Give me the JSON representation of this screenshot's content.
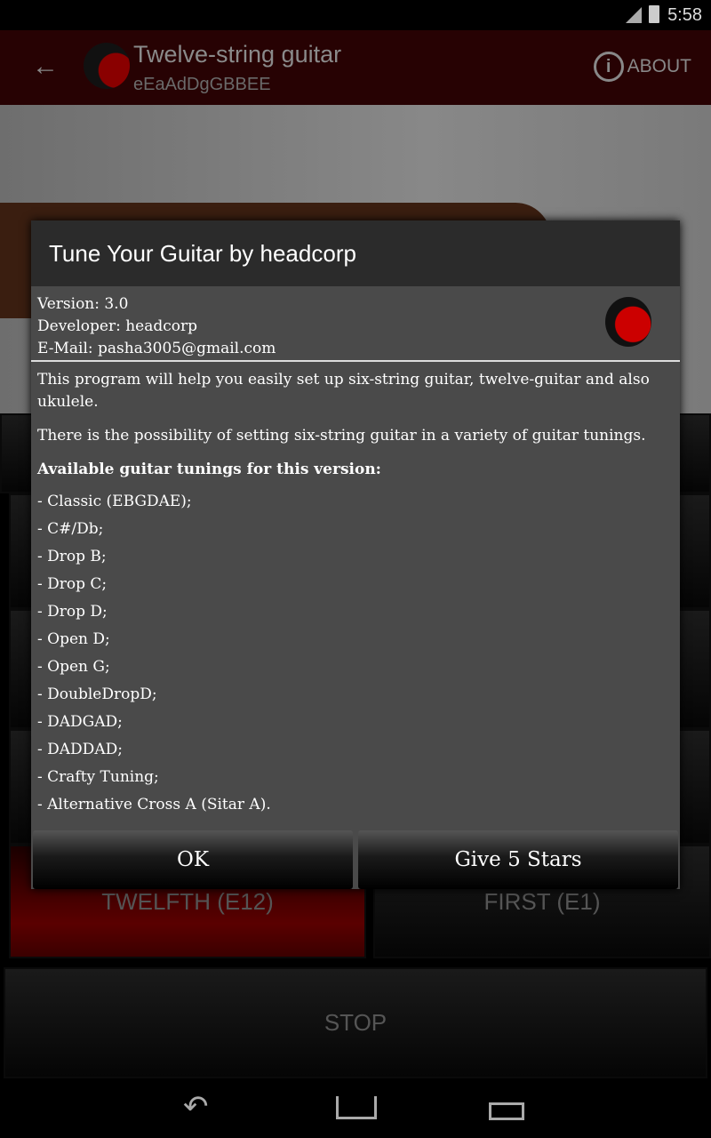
{
  "status": {
    "time": "5:58"
  },
  "appbar": {
    "title": "Twelve-string guitar",
    "subtitle": "eEaAdDgGBBEE",
    "about": "ABOUT"
  },
  "background_buttons": {
    "twelfth": "TWELFTH (E12)",
    "first": "FIRST (E1)",
    "stop": "STOP"
  },
  "dialog": {
    "title": "Tune Your Guitar by headcorp",
    "version": "Version: 3.0",
    "developer": "Developer: headcorp",
    "email": "E-Mail: pasha3005@gmail.com",
    "intro": "This program will help you easily set up six-string guitar, twelve-guitar and also ukulele.",
    "possibility": "There is the possibility of setting six-string guitar in a variety of guitar tunings.",
    "heading": "Available guitar tunings for this version:",
    "tunings": [
      "- Classic (EBGDAE);",
      "- C#/Db;",
      "- Drop B;",
      "- Drop C;",
      "- Drop D;",
      "- Open D;",
      "- Open G;",
      "- DoubleDropD;",
      "- DADGAD;",
      "- DADDAD;",
      "- Crafty Tuning;",
      "- Alternative Cross A (Sitar A)."
    ],
    "ok": "OK",
    "stars": "Give 5 Stars"
  },
  "colors": {
    "appbar": "#270203",
    "accent_red": "#5a0000",
    "dialog_bg": "#4a4a4a"
  }
}
